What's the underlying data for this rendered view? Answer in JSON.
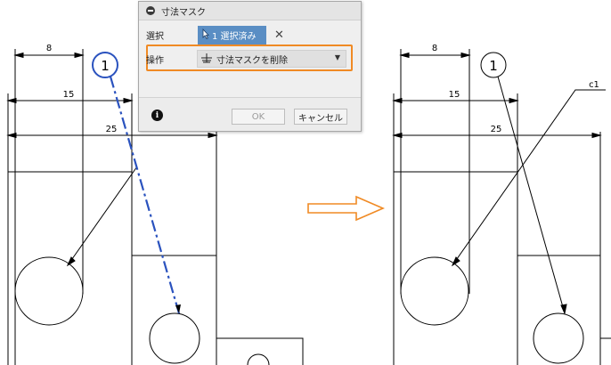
{
  "drawing": {
    "left": {
      "dim_8": "8",
      "dim_15": "15",
      "dim_25": "25",
      "balloon_number": "1"
    },
    "right": {
      "dim_8": "8",
      "dim_15": "15",
      "dim_25": "25",
      "balloon_number": "1",
      "leader_label": "c1"
    },
    "transition_arrow_color": "#f08a24",
    "selection_color": "#2a52be"
  },
  "dialog": {
    "title": "寸法マスク",
    "select_label": "選択",
    "select_value": "1 選択済み",
    "operation_label": "操作",
    "operation_value": "寸法マスクを削除",
    "ok_label": "OK",
    "cancel_label": "キャンセル",
    "accent_color": "#f08a24",
    "select_button_color": "#5a8ec4"
  }
}
